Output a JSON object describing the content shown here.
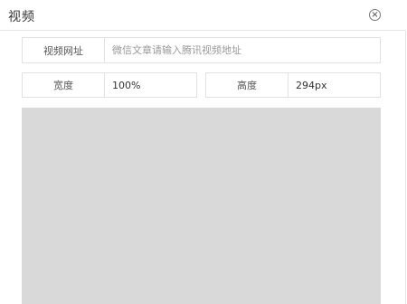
{
  "dialog": {
    "title": "视频",
    "close_symbol": "×"
  },
  "url_row": {
    "label": "视频网址",
    "placeholder": "微信文章请输入腾讯视频地址",
    "value": ""
  },
  "width_row": {
    "label": "宽度",
    "value": "100%"
  },
  "height_row": {
    "label": "高度",
    "value": "294px"
  },
  "preview": {
    "color": "#d9d9d9"
  }
}
